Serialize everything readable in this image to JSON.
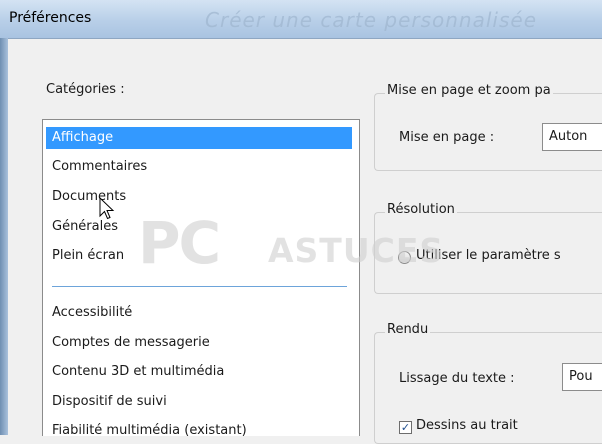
{
  "window": {
    "title": "Préférences",
    "ghost_title": "Créer une carte personnalisée"
  },
  "categories": {
    "label": "Catégories :",
    "group1": [
      "Affichage",
      "Commentaires",
      "Documents",
      "Générales",
      "Plein écran"
    ],
    "group2": [
      "Accessibilité",
      "Comptes de messagerie",
      "Contenu 3D et multimédia",
      "Dispositif de suivi",
      "Fiabilité multimédia (existant)"
    ],
    "selected": "Affichage"
  },
  "layout_zoom": {
    "title": "Mise en page et zoom pa",
    "page_label": "Mise en page :",
    "page_value": "Auton"
  },
  "resolution": {
    "title": "Résolution",
    "radio_label": "Utiliser le paramètre s"
  },
  "rendering": {
    "title": "Rendu",
    "smoothing_label": "Lissage du texte :",
    "smoothing_value": "Pou",
    "line_art_label": "Dessins au trait"
  },
  "watermark": {
    "pc": "PC",
    "astuces": "ASTUCES"
  },
  "colors": {
    "selection": "#3399ff",
    "separator": "#6da4da"
  },
  "icons": {
    "cursor": "arrow-cursor-icon",
    "check": "checkmark-icon"
  }
}
